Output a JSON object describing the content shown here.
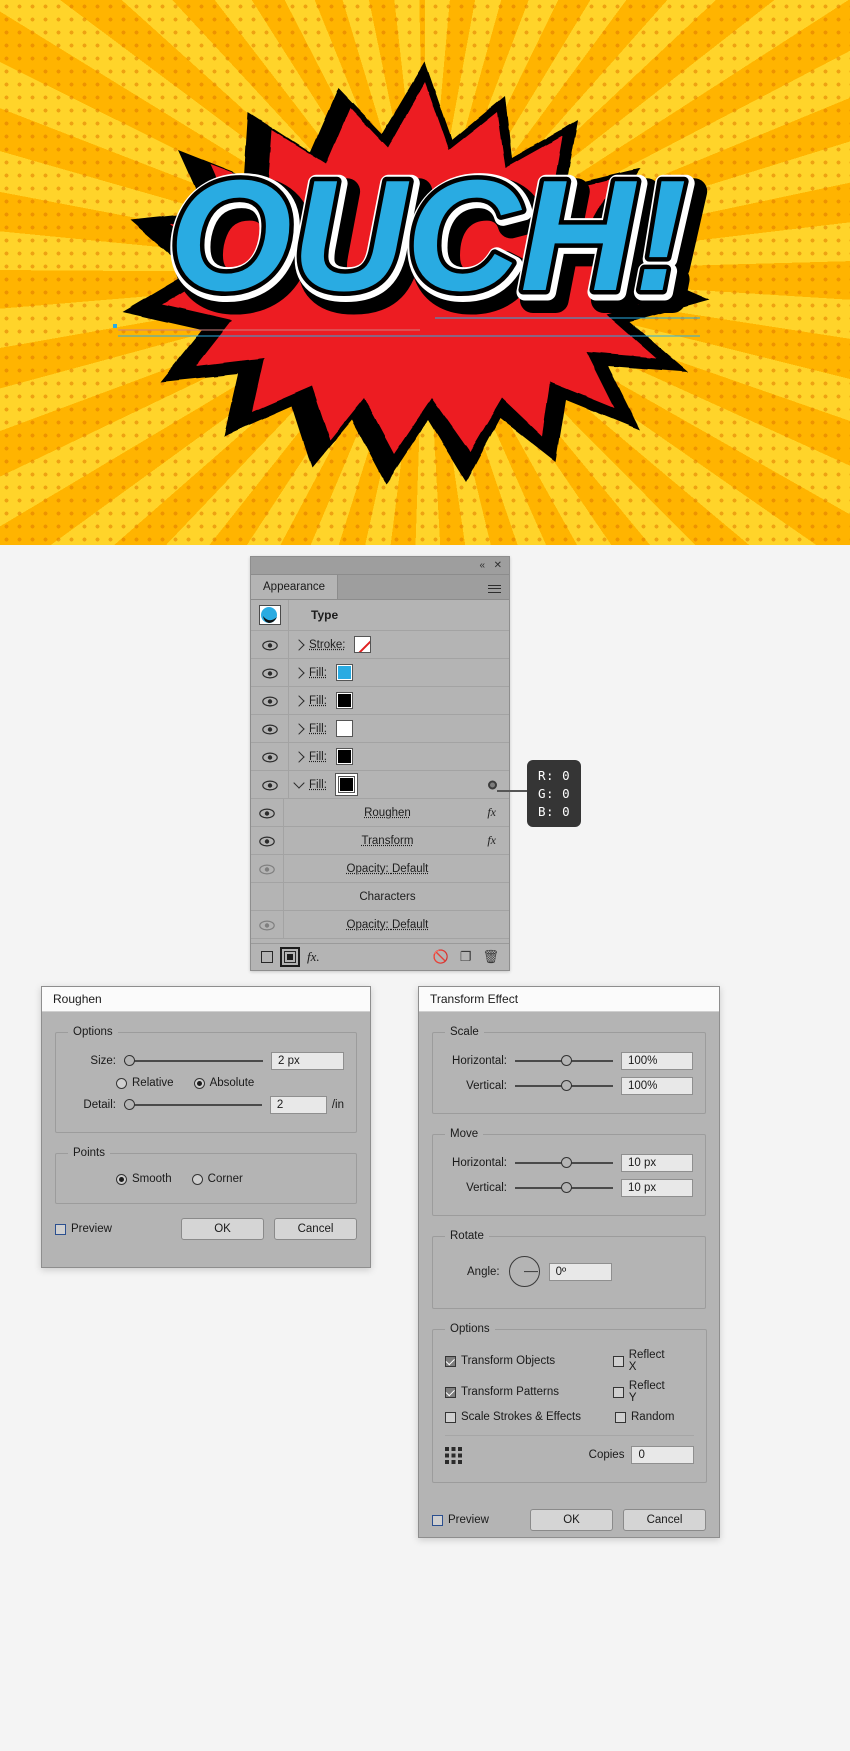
{
  "artwork": {
    "word": "OUCH!",
    "fill_color": "#29ABE2",
    "burst_color": "#ED1C24",
    "outline_color": "#000000",
    "highlight_color": "#FFFFFF",
    "bg_color": "#FFC20E",
    "ray_color": "#FFD42A",
    "dot_color": "#E07800"
  },
  "appearance_panel": {
    "tab_label": "Appearance",
    "collapse_icon": "«",
    "close_icon": "✕",
    "menu_icon": "panel-menu-icon",
    "object_type": "Type",
    "rows": [
      {
        "label": "Stroke:",
        "swatch": "none",
        "color": "#ED1C24",
        "expander": "right",
        "visible": true,
        "underline": true
      },
      {
        "label": "Fill:",
        "swatch": "solid",
        "color": "#29ABE2",
        "expander": "right",
        "visible": true,
        "underline": true
      },
      {
        "label": "Fill:",
        "swatch": "solid",
        "color": "#000000",
        "expander": "right",
        "visible": true,
        "underline": true
      },
      {
        "label": "Fill:",
        "swatch": "solid",
        "color": "#FFFFFF",
        "expander": "right",
        "visible": true,
        "underline": true
      },
      {
        "label": "Fill:",
        "swatch": "solid",
        "color": "#000000",
        "expander": "right",
        "visible": true,
        "underline": true
      },
      {
        "label": "Fill:",
        "swatch": "selected",
        "color": "#000000",
        "expander": "down",
        "visible": true,
        "underline": true
      }
    ],
    "effects": [
      {
        "label": "Roughen",
        "fx": "fx",
        "visible": true
      },
      {
        "label": "Transform",
        "fx": "fx",
        "visible": true
      }
    ],
    "opacity_row": {
      "label": "Opacity:",
      "value": "Default",
      "visible": false
    },
    "characters_row": {
      "label": "Characters"
    },
    "characters_opacity_row": {
      "label": "Opacity:",
      "value": "Default",
      "visible": false
    },
    "footer": {
      "add_new_stroke": "add-new-stroke",
      "add_new_fill": "add-new-fill",
      "fx_label": "fx.",
      "clear_appearance": "clear-appearance",
      "duplicate_item": "duplicate-item",
      "delete_item": "delete-item"
    }
  },
  "color_tooltip": {
    "r": "R: 0",
    "g": "G: 0",
    "b": "B: 0"
  },
  "roughen_dialog": {
    "title": "Roughen",
    "options_legend": "Options",
    "size_label": "Size:",
    "size_value": "2 px",
    "size_slider_pct": 2,
    "relative_label": "Relative",
    "absolute_label": "Absolute",
    "size_mode": "Absolute",
    "detail_label": "Detail:",
    "detail_value": "2",
    "detail_unit": "/in",
    "detail_slider_pct": 2,
    "points_legend": "Points",
    "smooth_label": "Smooth",
    "corner_label": "Corner",
    "point_mode": "Smooth",
    "preview_label": "Preview",
    "preview_checked": false,
    "ok_label": "OK",
    "cancel_label": "Cancel"
  },
  "transform_dialog": {
    "title": "Transform Effect",
    "scale_legend": "Scale",
    "scale_horizontal_label": "Horizontal:",
    "scale_horizontal_value": "100%",
    "scale_horizontal_pct": 50,
    "scale_vertical_label": "Vertical:",
    "scale_vertical_value": "100%",
    "scale_vertical_pct": 50,
    "move_legend": "Move",
    "move_horizontal_label": "Horizontal:",
    "move_horizontal_value": "10 px",
    "move_horizontal_pct": 50,
    "move_vertical_label": "Vertical:",
    "move_vertical_value": "10 px",
    "move_vertical_pct": 50,
    "rotate_legend": "Rotate",
    "angle_label": "Angle:",
    "angle_value": "0º",
    "options_legend": "Options",
    "transform_objects_label": "Transform Objects",
    "transform_objects_checked": true,
    "transform_patterns_label": "Transform Patterns",
    "transform_patterns_checked": true,
    "scale_strokes_label": "Scale Strokes & Effects",
    "scale_strokes_checked": false,
    "reflect_x_label": "Reflect X",
    "reflect_x_checked": false,
    "reflect_y_label": "Reflect Y",
    "reflect_y_checked": false,
    "random_label": "Random",
    "random_checked": false,
    "copies_label": "Copies",
    "copies_value": "0",
    "preview_label": "Preview",
    "preview_checked": false,
    "ok_label": "OK",
    "cancel_label": "Cancel"
  }
}
